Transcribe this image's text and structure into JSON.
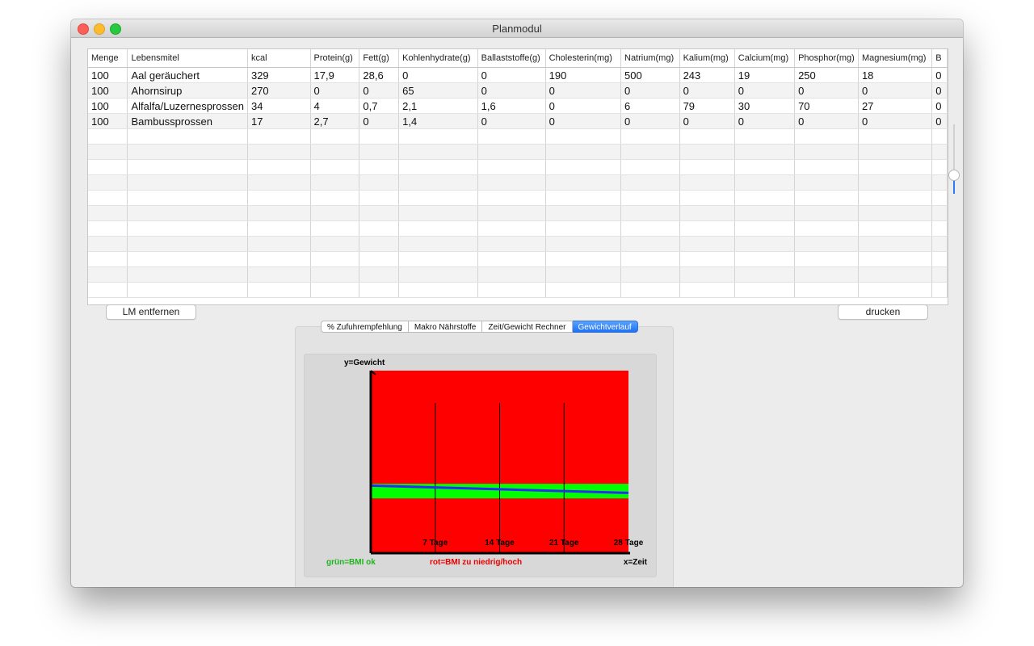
{
  "window": {
    "title": "Planmodul"
  },
  "table": {
    "columns": [
      "Menge",
      "Lebensmitel",
      "kcal",
      "Protein(g)",
      "Fett(g)",
      "Kohlenhydrate(g)",
      "Ballaststoffe(g)",
      "Cholesterin(mg)",
      "Natrium(mg)",
      "Kalium(mg)",
      "Calcium(mg)",
      "Phosphor(mg)",
      "Magnesium(mg)",
      "B"
    ],
    "rows": [
      [
        "100",
        "Aal geräuchert",
        "329",
        "17,9",
        "28,6",
        "0",
        "0",
        "190",
        "500",
        "243",
        "19",
        "250",
        "18",
        "0"
      ],
      [
        "100",
        "Ahornsirup",
        "270",
        "0",
        "0",
        "65",
        "0",
        "0",
        "0",
        "0",
        "0",
        "0",
        "0",
        "0"
      ],
      [
        "100",
        "Alfalfa/Luzernesprossen",
        "34",
        "4",
        "0,7",
        "2,1",
        "1,6",
        "0",
        "6",
        "79",
        "30",
        "70",
        "27",
        "0"
      ],
      [
        "100",
        "Bambussprossen",
        "17",
        "2,7",
        "0",
        "1,4",
        "0",
        "0",
        "0",
        "0",
        "0",
        "0",
        "0",
        "0"
      ]
    ]
  },
  "buttons": {
    "remove": "LM entfernen",
    "print": "drucken"
  },
  "tabs": [
    {
      "label": "% Zufuhrempfehlung",
      "active": false
    },
    {
      "label": "Makro Nährstoffe",
      "active": false
    },
    {
      "label": "Zeit/Gewicht Rechner",
      "active": false
    },
    {
      "label": "Gewichtverlauf",
      "active": true
    }
  ],
  "chart_data": {
    "type": "line",
    "ylabel": "y=Gewicht",
    "xlabel": "x=Zeit",
    "x_ticks": [
      {
        "day": 7,
        "label": "7 Tage"
      },
      {
        "day": 14,
        "label": "14 Tage"
      },
      {
        "day": 21,
        "label": "21 Tage"
      },
      {
        "day": 28,
        "label": "28 Tage"
      }
    ],
    "xlim": [
      0,
      28
    ],
    "ylim": [
      0,
      1
    ],
    "bmi_ok_band": [
      0.3,
      0.38
    ],
    "weight_line": {
      "x": [
        0,
        28
      ],
      "y": [
        0.37,
        0.33
      ]
    },
    "colors": {
      "bmi_bad": "#ff0000",
      "bmi_ok": "#00ff00",
      "weight": "#2b2ef0",
      "axis": "#000000",
      "legend_green": "#1fb51f",
      "legend_red": "#ee0000"
    },
    "legend": {
      "ok": "grün=BMI ok",
      "bad": "rot=BMI zu niedrig/hoch"
    }
  }
}
